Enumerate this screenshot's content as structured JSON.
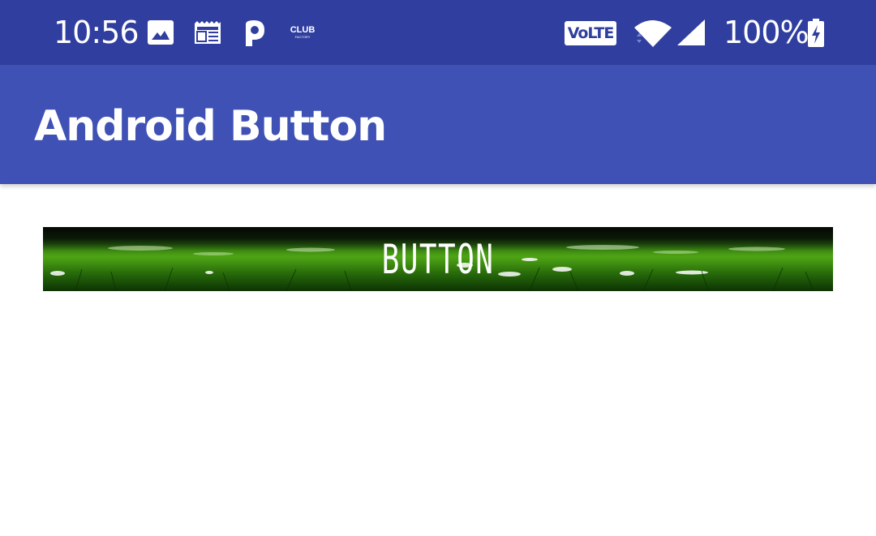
{
  "status_bar": {
    "time": "10:56",
    "notification_icons": [
      "gallery-icon",
      "news-icon",
      "p-app-icon",
      "club-factory-icon"
    ],
    "club_factory_text": "CLUB",
    "club_factory_subtext": "FACTORY",
    "volte_label": "VoLTE",
    "battery_percent": "100%",
    "battery_charging": true
  },
  "app_bar": {
    "title": "Android Button",
    "color": "#3F51B5",
    "status_color": "#303F9F"
  },
  "main": {
    "button_label": "BUTTON",
    "button_background": "grass-image"
  }
}
